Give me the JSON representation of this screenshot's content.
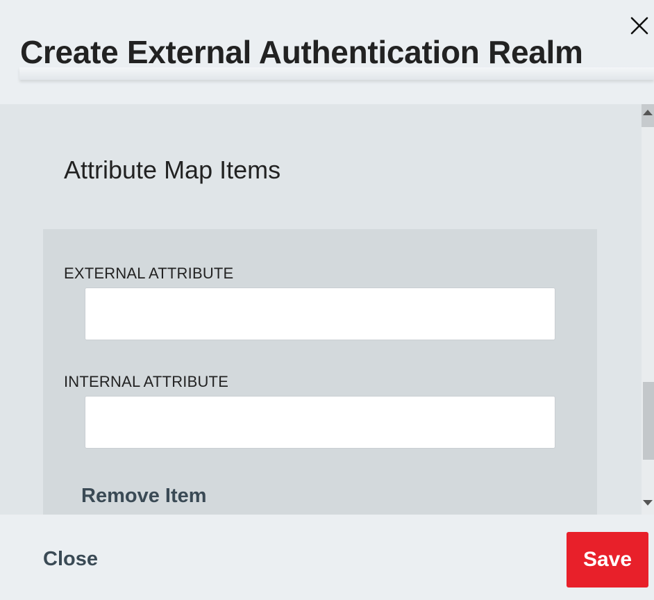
{
  "dialog": {
    "title": "Create External Authentication Realm",
    "close_icon": "close-icon"
  },
  "section": {
    "heading": "Attribute Map Items"
  },
  "map_item": {
    "external_label": "EXTERNAL ATTRIBUTE",
    "external_value": "",
    "internal_label": "INTERNAL ATTRIBUTE",
    "internal_value": "",
    "remove_label": "Remove Item"
  },
  "footer": {
    "close_label": "Close",
    "save_label": "Save"
  },
  "colors": {
    "accent": "#e8202a",
    "link": "#3a4a55"
  }
}
